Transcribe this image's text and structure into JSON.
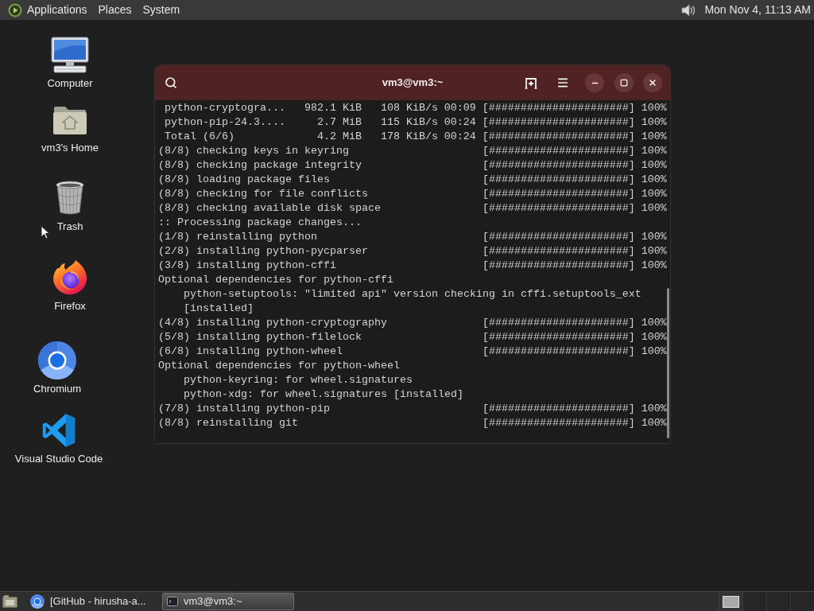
{
  "top_panel": {
    "menus": [
      "Applications",
      "Places",
      "System"
    ],
    "clock": "Mon Nov 4, 11:13 AM"
  },
  "desktop_icons": [
    {
      "label": "Computer",
      "kind": "computer"
    },
    {
      "label": "vm3's Home",
      "kind": "home"
    },
    {
      "label": "Trash",
      "kind": "trash"
    },
    {
      "label": "Firefox",
      "kind": "firefox"
    },
    {
      "label": "Chromium",
      "kind": "chromium"
    },
    {
      "label": "Visual Studio Code",
      "kind": "vscode"
    }
  ],
  "terminal": {
    "title": "vm3@vm3:~",
    "lines": [
      {
        "kind": "download",
        "name": "python-cryptogra...",
        "size": "982.1 KiB",
        "speed": "108 KiB/s",
        "time": "00:09",
        "bar": "[######################]",
        "percent": "100%"
      },
      {
        "kind": "download",
        "name": "python-pip-24.3....",
        "size": "2.7 MiB",
        "speed": "115 KiB/s",
        "time": "00:24",
        "bar": "[######################]",
        "percent": "100%"
      },
      {
        "kind": "download",
        "name": "Total (6/6)",
        "size": "4.2 MiB",
        "speed": "178 KiB/s",
        "time": "00:24",
        "bar": "[######################]",
        "percent": "100%"
      },
      {
        "kind": "step",
        "text": "(8/8) checking keys in keyring",
        "bar": "[######################]",
        "percent": "100%"
      },
      {
        "kind": "step",
        "text": "(8/8) checking package integrity",
        "bar": "[######################]",
        "percent": "100%"
      },
      {
        "kind": "step",
        "text": "(8/8) loading package files",
        "bar": "[######################]",
        "percent": "100%"
      },
      {
        "kind": "step",
        "text": "(8/8) checking for file conflicts",
        "bar": "[######################]",
        "percent": "100%"
      },
      {
        "kind": "step",
        "text": "(8/8) checking available disk space",
        "bar": "[######################]",
        "percent": "100%"
      },
      {
        "kind": "message",
        "text": ":: Processing package changes..."
      },
      {
        "kind": "step",
        "text": "(1/8) reinstalling python",
        "bar": "[######################]",
        "percent": "100%"
      },
      {
        "kind": "step",
        "text": "(2/8) installing python-pycparser",
        "bar": "[######################]",
        "percent": "100%"
      },
      {
        "kind": "step",
        "text": "(3/8) installing python-cffi",
        "bar": "[######################]",
        "percent": "100%"
      },
      {
        "kind": "message",
        "text": "Optional dependencies for python-cffi"
      },
      {
        "kind": "detail",
        "text": "python-setuptools: \"limited api\" version checking in cffi.setuptools_ext"
      },
      {
        "kind": "detail",
        "text": "[installed]"
      },
      {
        "kind": "step",
        "text": "(4/8) installing python-cryptography",
        "bar": "[######################]",
        "percent": "100%"
      },
      {
        "kind": "step",
        "text": "(5/8) installing python-filelock",
        "bar": "[######################]",
        "percent": "100%"
      },
      {
        "kind": "step",
        "text": "(6/8) installing python-wheel",
        "bar": "[######################]",
        "percent": "100%"
      },
      {
        "kind": "message",
        "text": "Optional dependencies for python-wheel"
      },
      {
        "kind": "detail",
        "text": "python-keyring: for wheel.signatures"
      },
      {
        "kind": "detail",
        "text": "python-xdg: for wheel.signatures [installed]"
      },
      {
        "kind": "step",
        "text": "(7/8) installing python-pip",
        "bar": "[######################]",
        "percent": "100%"
      },
      {
        "kind": "step",
        "text": "(8/8) reinstalling git",
        "bar": "[######################]",
        "percent": "100%"
      }
    ]
  },
  "taskbar": {
    "items": [
      {
        "label": "[GitHub - hirusha-a...",
        "kind": "browser",
        "selected": false
      },
      {
        "label": "vm3@vm3:~",
        "kind": "terminal",
        "selected": true
      }
    ]
  }
}
